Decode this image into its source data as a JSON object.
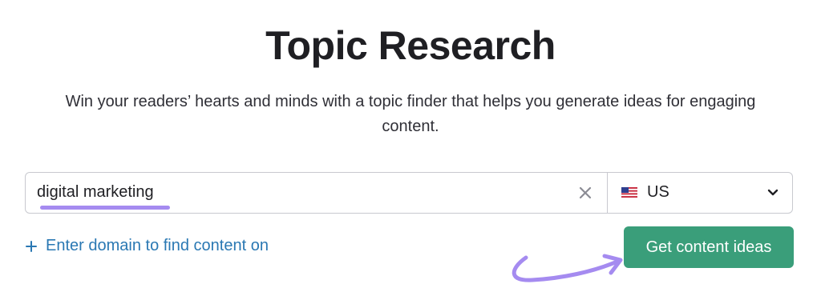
{
  "page": {
    "title": "Topic Research",
    "subtitle": "Win your readers’ hearts and minds with a topic finder that helps you generate ideas for engaging content."
  },
  "search": {
    "keyword_value": "digital marketing",
    "clear_icon": "close-icon",
    "country": {
      "flag_icon": "us-flag-icon",
      "selected": "US",
      "dropdown_icon": "chevron-down-icon"
    }
  },
  "actions": {
    "domain_link_label": "Enter domain to find content on",
    "domain_link_icon": "plus-icon",
    "cta_label": "Get content ideas"
  },
  "colors": {
    "title": "#1f1f23",
    "link": "#2a78b3",
    "cta_background": "#3a9e7a",
    "highlight": "#a58bf0"
  }
}
